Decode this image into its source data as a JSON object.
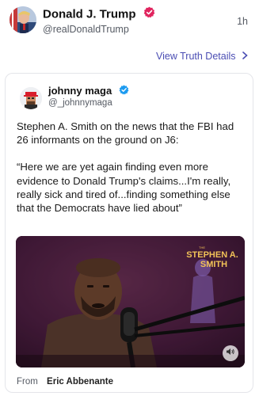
{
  "post": {
    "author_name": "Donald J. Trump",
    "author_handle": "@realDonaldTrump",
    "timestamp": "1h",
    "view_details_label": "View Truth Details",
    "verified_color": "#e0245e"
  },
  "quote": {
    "author_name": "johnny maga",
    "author_handle": "@_johnnymaga",
    "verified_color": "#1d9bf0",
    "paragraph_1": "Stephen A. Smith on the news that the FBI had 26 informants on the ground on J6:",
    "paragraph_2": "“Here we are yet again finding even more evidence to Donald Trump's claims...I'm really, really sick and tired of...finding something else that the Democrats have lied about”",
    "media": {
      "logo_line_1": "STEPHEN A.",
      "logo_line_2": "SMITH",
      "mute_icon": "speaker-icon"
    },
    "from_label": "From",
    "from_name": "Eric Abbenante"
  },
  "colors": {
    "link": "#4a4db3",
    "muted_text": "#555a63",
    "card_border": "#e4e5ea"
  }
}
